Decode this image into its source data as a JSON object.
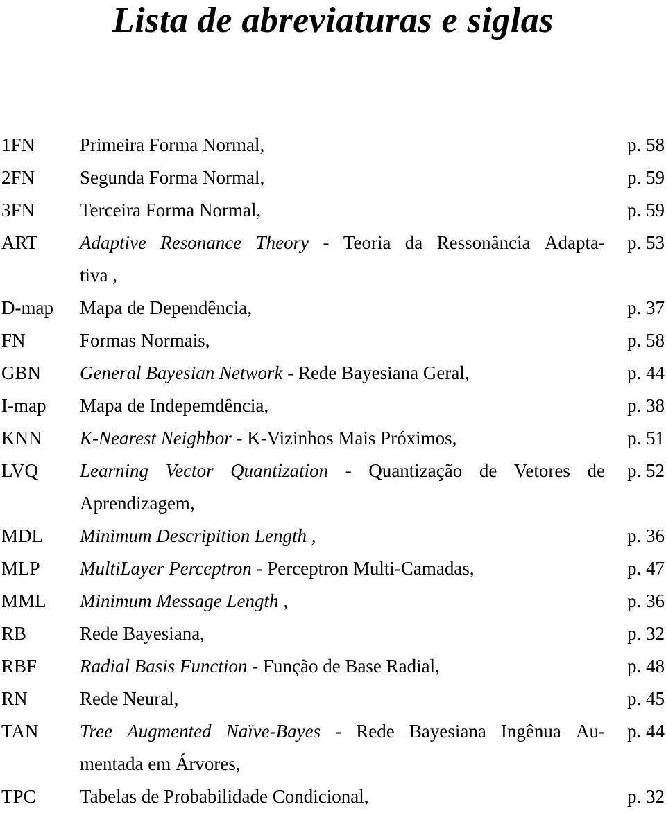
{
  "document": {
    "title": "Lista de abreviaturas e siglas",
    "page_prefix": "p.",
    "entries": [
      {
        "acronym": "1FN",
        "line1": [
          {
            "text": "Primeira Forma Normal,",
            "italic": false
          }
        ],
        "page": "p. 58"
      },
      {
        "acronym": "2FN",
        "line1": [
          {
            "text": "Segunda Forma Normal,",
            "italic": false
          }
        ],
        "page": "p. 59"
      },
      {
        "acronym": "3FN",
        "line1": [
          {
            "text": "Terceira Forma Normal,",
            "italic": false
          }
        ],
        "page": "p. 59"
      },
      {
        "acronym": "ART",
        "line1_words": [
          {
            "text": "Adaptive",
            "italic": true
          },
          {
            "text": "Resonance",
            "italic": true
          },
          {
            "text": "Theory",
            "italic": true
          },
          {
            "text": "-",
            "italic": false
          },
          {
            "text": "Teoria",
            "italic": false
          },
          {
            "text": "da",
            "italic": false
          },
          {
            "text": "Ressonância",
            "italic": false
          },
          {
            "text": "Adapta-",
            "italic": false
          }
        ],
        "line2": [
          {
            "text": "tiva ,",
            "italic": false
          }
        ],
        "page": "p. 53"
      },
      {
        "acronym": "D-map",
        "line1": [
          {
            "text": "Mapa de Dependência,",
            "italic": false
          }
        ],
        "page": "p. 37"
      },
      {
        "acronym": "FN",
        "line1": [
          {
            "text": "Formas Normais,",
            "italic": false
          }
        ],
        "page": "p. 58"
      },
      {
        "acronym": "GBN",
        "line1": [
          {
            "text": "General Bayesian Network",
            "italic": true
          },
          {
            "text": " - Rede Bayesiana Geral,",
            "italic": false
          }
        ],
        "page": "p. 44"
      },
      {
        "acronym": "I-map",
        "line1": [
          {
            "text": "Mapa de Indepemdência,",
            "italic": false
          }
        ],
        "page": "p. 38"
      },
      {
        "acronym": "KNN",
        "line1": [
          {
            "text": "K-Nearest Neighbor",
            "italic": true
          },
          {
            "text": " - K-Vizinhos Mais Próximos,",
            "italic": false
          }
        ],
        "page": "p. 51"
      },
      {
        "acronym": "LVQ",
        "line1_words": [
          {
            "text": "Learning",
            "italic": true
          },
          {
            "text": "Vector",
            "italic": true
          },
          {
            "text": "Quantization",
            "italic": true
          },
          {
            "text": "-",
            "italic": false
          },
          {
            "text": "Quantização",
            "italic": false
          },
          {
            "text": "de",
            "italic": false
          },
          {
            "text": "Vetores",
            "italic": false
          },
          {
            "text": "de",
            "italic": false
          }
        ],
        "line2": [
          {
            "text": "Aprendizagem,",
            "italic": false
          }
        ],
        "page": "p. 52"
      },
      {
        "acronym": "MDL",
        "line1": [
          {
            "text": "Minimum Descripition Length ,",
            "italic": true
          }
        ],
        "page": "p. 36"
      },
      {
        "acronym": "MLP",
        "line1": [
          {
            "text": "MultiLayer Perceptron",
            "italic": true
          },
          {
            "text": " - Perceptron Multi-Camadas,",
            "italic": false
          }
        ],
        "page": "p. 47"
      },
      {
        "acronym": "MML",
        "line1": [
          {
            "text": "Minimum Message Length ,",
            "italic": true
          }
        ],
        "page": "p. 36"
      },
      {
        "acronym": "RB",
        "line1": [
          {
            "text": "Rede Bayesiana,",
            "italic": false
          }
        ],
        "page": "p. 32"
      },
      {
        "acronym": "RBF",
        "line1": [
          {
            "text": "Radial Basis Function",
            "italic": true
          },
          {
            "text": " - Função de Base Radial,",
            "italic": false
          }
        ],
        "page": "p. 48"
      },
      {
        "acronym": "RN",
        "line1": [
          {
            "text": "Rede Neural,",
            "italic": false
          }
        ],
        "page": "p. 45"
      },
      {
        "acronym": "TAN",
        "line1_words": [
          {
            "text": "Tree",
            "italic": true
          },
          {
            "text": "Augmented",
            "italic": true
          },
          {
            "text": "Naïve-Bayes",
            "italic": true
          },
          {
            "text": "-",
            "italic": false
          },
          {
            "text": "Rede",
            "italic": false
          },
          {
            "text": "Bayesiana",
            "italic": false
          },
          {
            "text": "Ingênua",
            "italic": false
          },
          {
            "text": "Au-",
            "italic": false
          }
        ],
        "line2": [
          {
            "text": "mentada em Árvores,",
            "italic": false
          }
        ],
        "page": "p. 44"
      },
      {
        "acronym": "TPC",
        "line1": [
          {
            "text": "Tabelas de Probabilidade Condicional,",
            "italic": false
          }
        ],
        "page": "p. 32"
      }
    ]
  }
}
